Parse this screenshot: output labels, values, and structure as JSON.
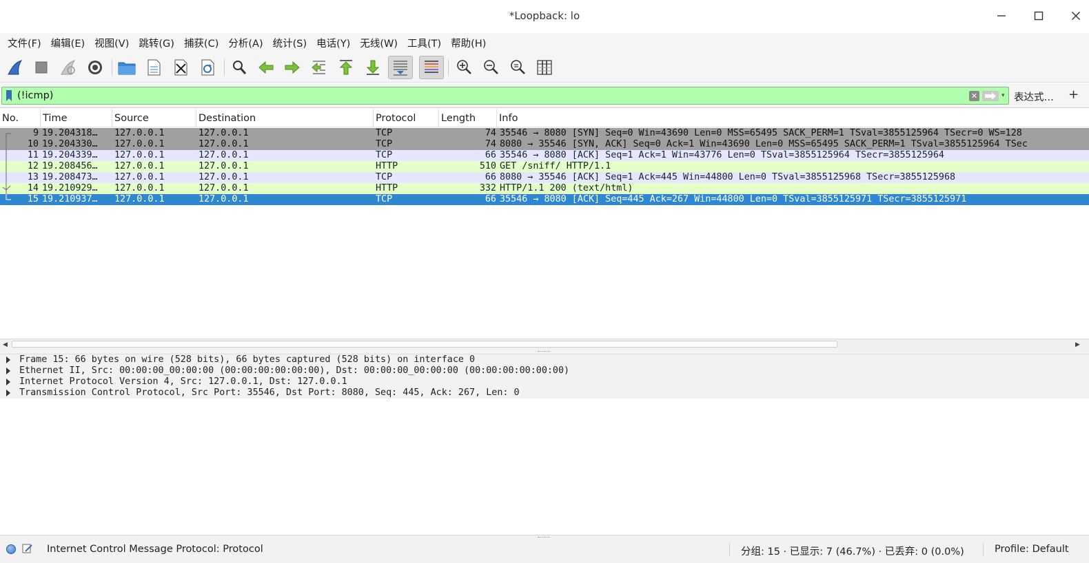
{
  "window": {
    "title": "*Loopback: lo",
    "minimize_glyph": "—",
    "maximize_glyph": "☐",
    "close_glyph": "✕"
  },
  "menu": [
    "文件(F)",
    "编辑(E)",
    "视图(V)",
    "跳转(G)",
    "捕获(C)",
    "分析(A)",
    "统计(S)",
    "电话(Y)",
    "无线(W)",
    "工具(T)",
    "帮助(H)"
  ],
  "toolbar": {
    "icons": [
      "shark-fin-start-icon",
      "stop-capture-icon",
      "restart-capture-icon",
      "capture-options-icon",
      "open-file-icon",
      "save-file-icon",
      "close-file-icon",
      "reload-file-icon",
      "find-packet-icon",
      "go-back-icon",
      "go-forward-icon",
      "go-to-packet-icon",
      "first-packet-icon",
      "last-packet-icon",
      "auto-scroll-icon",
      "colorize-icon",
      "zoom-in-icon",
      "zoom-out-icon",
      "normal-size-icon",
      "resize-columns-icon"
    ],
    "pressed": [
      "auto-scroll-icon",
      "colorize-icon"
    ]
  },
  "filter": {
    "value": "(!icmp)",
    "clear_glyph": "✕",
    "dropdown_glyph": "▾",
    "expression_label": "表达式…",
    "add_label": "+",
    "bg_color": "#afffaf"
  },
  "packet_list": {
    "columns": [
      "No.",
      "Time",
      "Source",
      "Destination",
      "Protocol",
      "Length",
      "Info"
    ],
    "rows": [
      {
        "no": "9",
        "time": "19.204318…",
        "src": "127.0.0.1",
        "dst": "127.0.0.1",
        "proto": "TCP",
        "len": "74",
        "info": "35546 → 8080 [SYN] Seq=0 Win=43690 Len=0 MSS=65495 SACK_PERM=1 TSval=3855125964 TSecr=0 WS=128",
        "bg": "#a0a0a0",
        "fg": "#101010",
        "tree": "start"
      },
      {
        "no": "10",
        "time": "19.204330…",
        "src": "127.0.0.1",
        "dst": "127.0.0.1",
        "proto": "TCP",
        "len": "74",
        "info": "8080 → 35546 [SYN, ACK] Seq=0 Ack=1 Win=43690 Len=0 MSS=65495 SACK_PERM=1 TSval=3855125964 TSec",
        "bg": "#a0a0a0",
        "fg": "#101010",
        "tree": "mid"
      },
      {
        "no": "11",
        "time": "19.204339…",
        "src": "127.0.0.1",
        "dst": "127.0.0.1",
        "proto": "TCP",
        "len": "66",
        "info": "35546 → 8080 [ACK] Seq=1 Ack=1 Win=43776 Len=0 TSval=3855125964 TSecr=3855125964",
        "bg": "#e7e6ff",
        "fg": "#12272e",
        "tree": "mid"
      },
      {
        "no": "12",
        "time": "19.208456…",
        "src": "127.0.0.1",
        "dst": "127.0.0.1",
        "proto": "HTTP",
        "len": "510",
        "info": "GET /sniff/ HTTP/1.1",
        "bg": "#e4ffc7",
        "fg": "#12272e",
        "tree": "mid"
      },
      {
        "no": "13",
        "time": "19.208473…",
        "src": "127.0.0.1",
        "dst": "127.0.0.1",
        "proto": "TCP",
        "len": "66",
        "info": "8080 → 35546 [ACK] Seq=1 Ack=445 Win=44800 Len=0 TSval=3855125968 TSecr=3855125968",
        "bg": "#e7e6ff",
        "fg": "#12272e",
        "tree": "mid"
      },
      {
        "no": "14",
        "time": "19.210929…",
        "src": "127.0.0.1",
        "dst": "127.0.0.1",
        "proto": "HTTP",
        "len": "332",
        "info": "HTTP/1.1 200   (text/html)",
        "bg": "#e4ffc7",
        "fg": "#12272e",
        "tree": "response"
      },
      {
        "no": "15",
        "time": "19.210937…",
        "src": "127.0.0.1",
        "dst": "127.0.0.1",
        "proto": "TCP",
        "len": "66",
        "info": "35546 → 8080 [ACK] Seq=445 Ack=267 Win=44800 Len=0 TSval=3855125971 TSecr=3855125971",
        "bg": "#2f87cf",
        "fg": "#ffffff",
        "tree": "end"
      }
    ]
  },
  "details": [
    "Frame 15: 66 bytes on wire (528 bits), 66 bytes captured (528 bits) on interface 0",
    "Ethernet II, Src: 00:00:00_00:00:00 (00:00:00:00:00:00), Dst: 00:00:00_00:00:00 (00:00:00:00:00:00)",
    "Internet Protocol Version 4, Src: 127.0.0.1, Dst: 127.0.0.1",
    "Transmission Control Protocol, Src Port: 35546, Dst Port: 8080, Seq: 445, Ack: 267, Len: 0"
  ],
  "status": {
    "message": "Internet Control Message Protocol: Protocol",
    "packets": "分组: 15 · 已显示: 7 (46.7%) · 已丢弃: 0 (0.0%)",
    "profile": "Profile: Default"
  },
  "scrollbar": {
    "left_glyph": "◀",
    "right_glyph": "▶"
  }
}
